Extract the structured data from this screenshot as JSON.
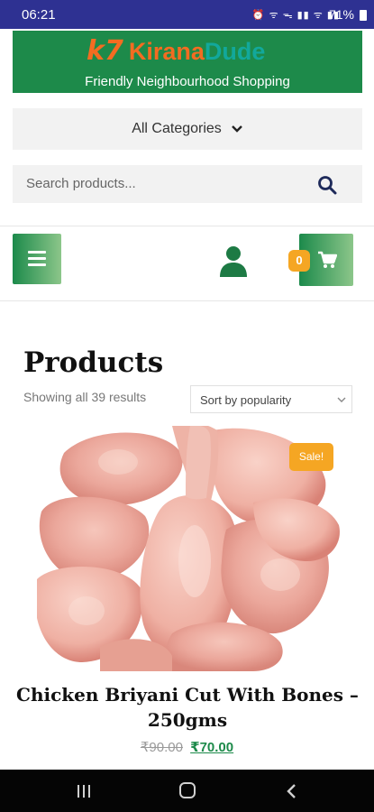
{
  "status_bar": {
    "time": "06:21",
    "indicators": "⏰ ᯤ ᯓ ▮▮ ᯤ ▮▮",
    "battery": "71%"
  },
  "banner": {
    "logo_mark": "k7",
    "logo_kirana": "Kirana",
    "logo_dude": "Dude",
    "tagline": "Friendly Neighbourhood Shopping",
    "color": "#1d8a4a"
  },
  "categories": {
    "label": "All Categories"
  },
  "search": {
    "placeholder": "Search products..."
  },
  "header_actions": {
    "cart_count": "0"
  },
  "products_page": {
    "heading": "Products",
    "result_count": "Showing all 39 results",
    "sort_selected": "Sort by popularity"
  },
  "product": {
    "sale_badge": "Sale!",
    "title": "Chicken Briyani Cut With Bones – 250gms",
    "old_price": "₹90.00",
    "new_price": "₹70.00"
  },
  "colors": {
    "status_bar": "#2e3192",
    "accent_orange": "#f5a623",
    "brand_green": "#1d8a4a"
  },
  "icons": [
    "chevron-down-icon",
    "search-icon",
    "menu-icon",
    "user-icon",
    "cart-icon",
    "recent-apps-icon",
    "home-icon",
    "back-icon"
  ]
}
